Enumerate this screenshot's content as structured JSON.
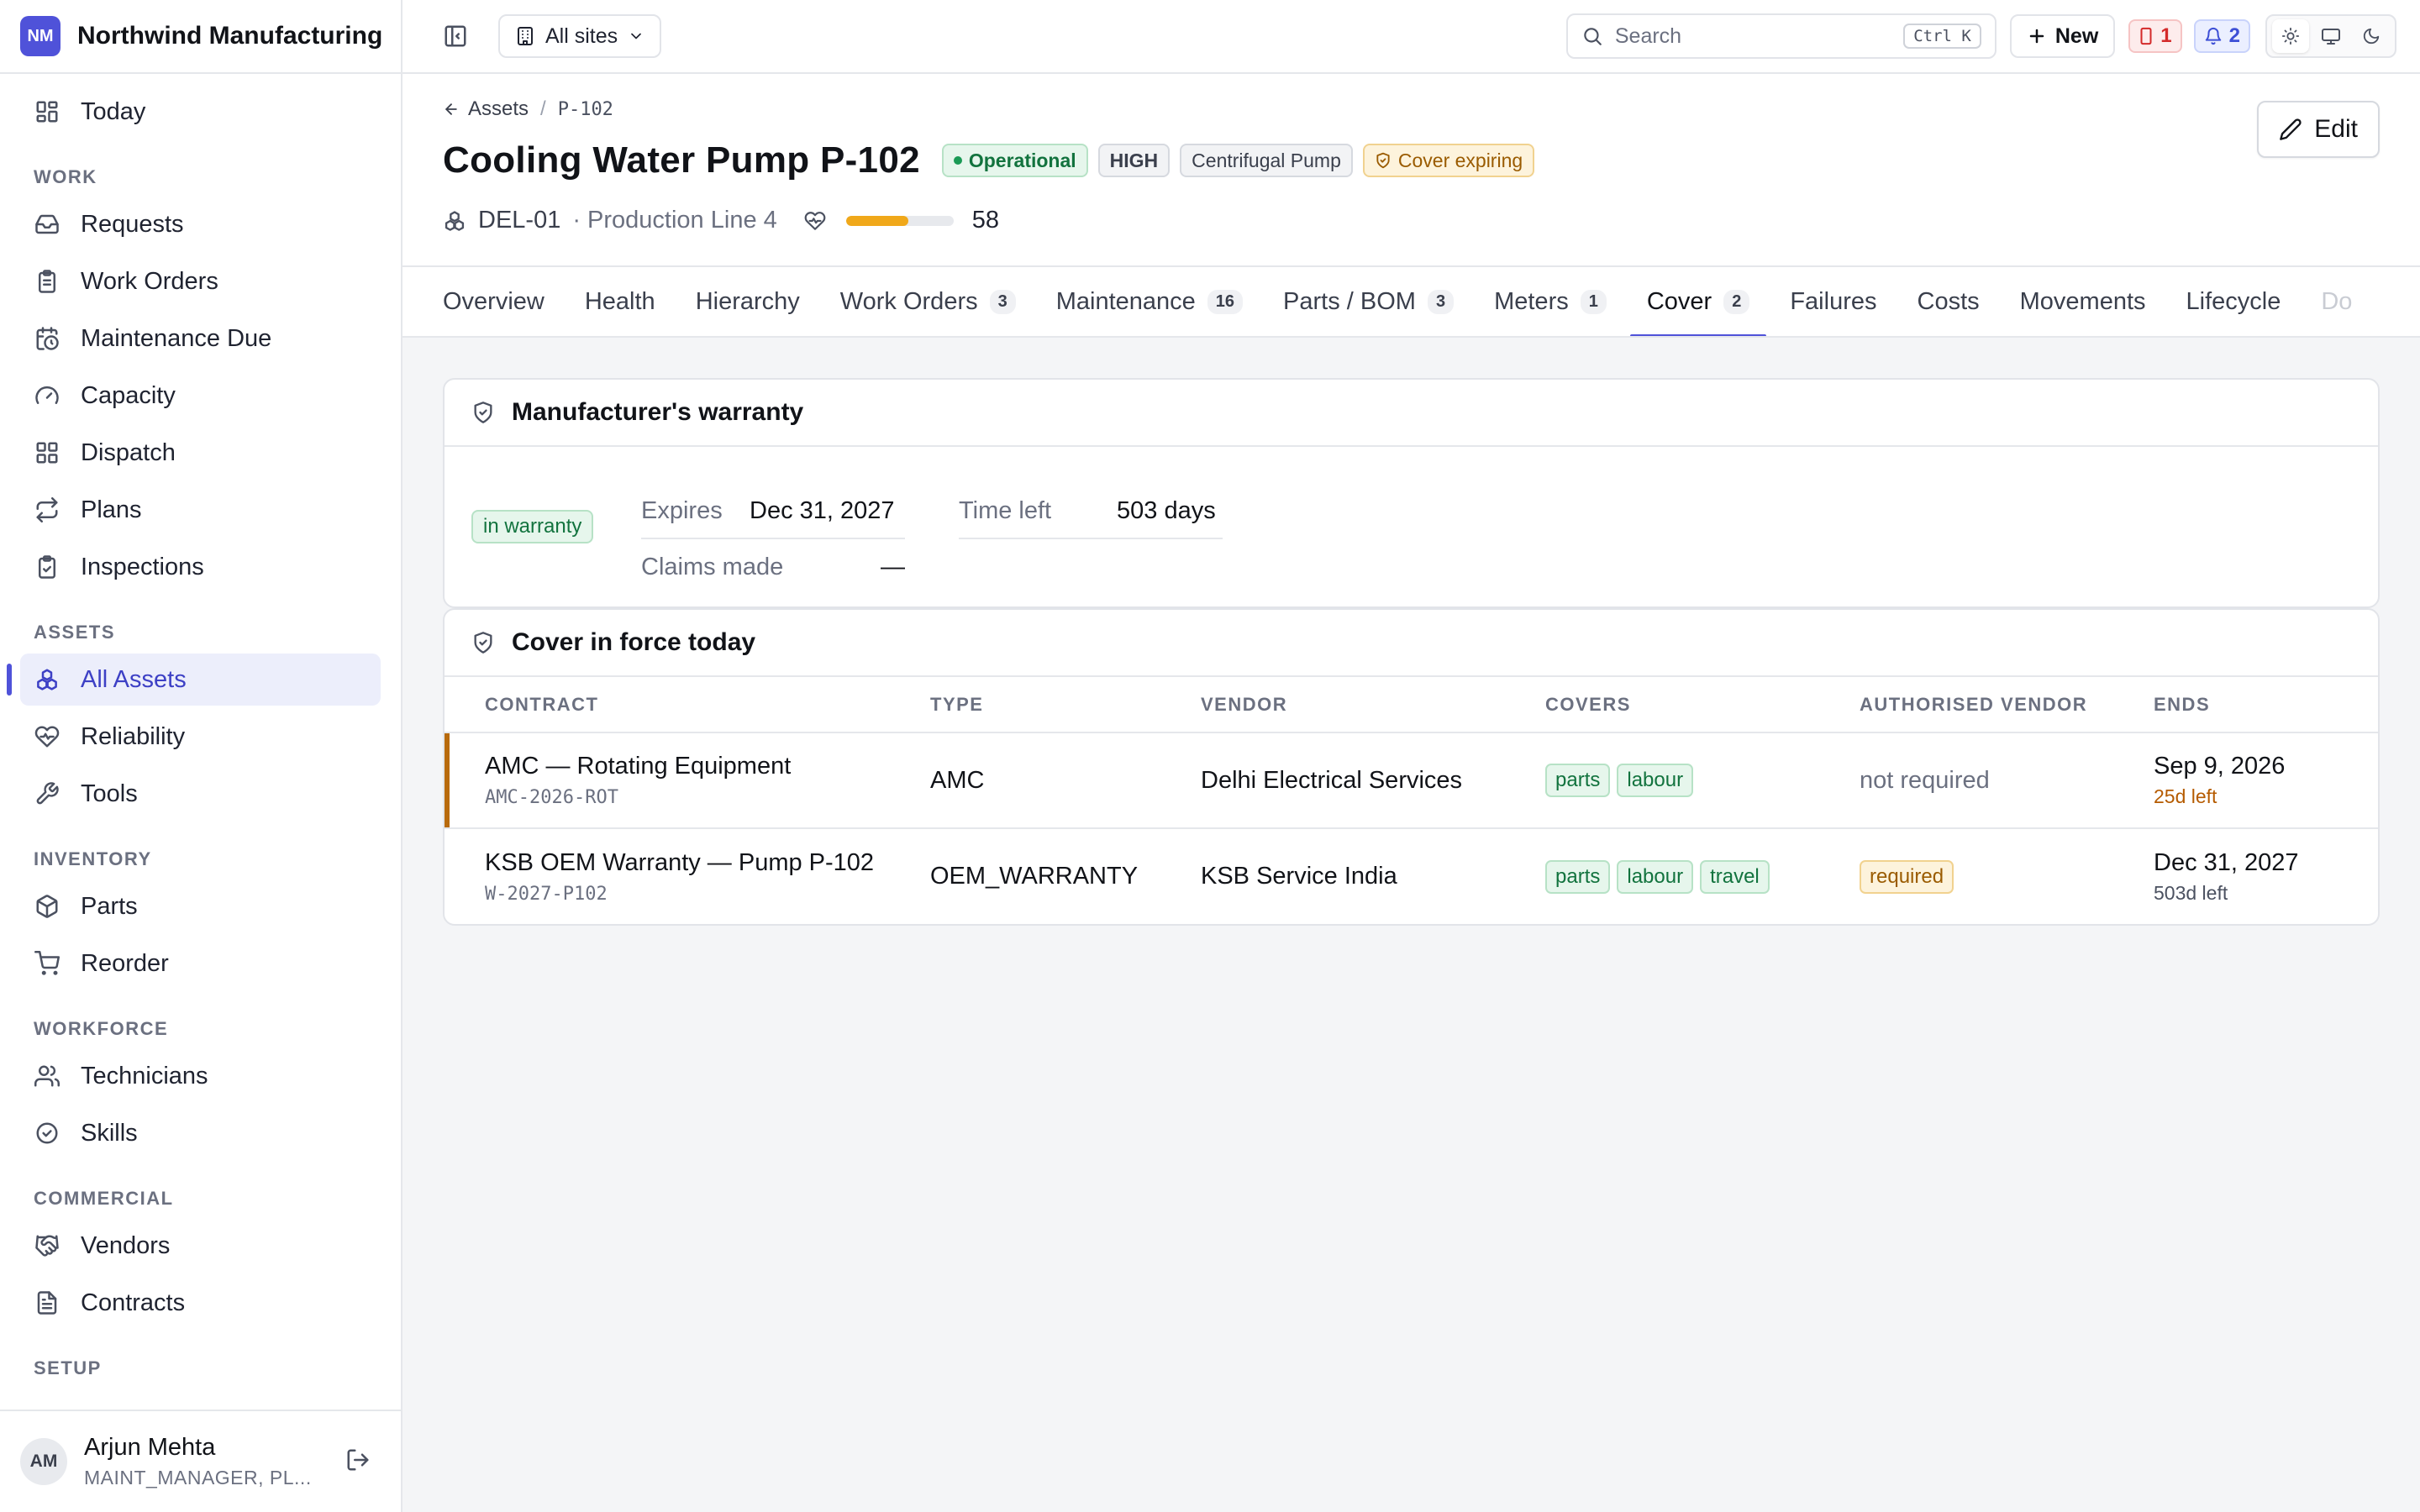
{
  "brand": {
    "initials": "NM",
    "name": "Northwind Manufacturing"
  },
  "sidebar": {
    "top": [
      {
        "label": "Today",
        "icon": "dashboard-icon"
      }
    ],
    "sections": [
      {
        "title": "WORK",
        "items": [
          {
            "label": "Requests",
            "icon": "inbox-icon"
          },
          {
            "label": "Work Orders",
            "icon": "clipboard-icon"
          },
          {
            "label": "Maintenance Due",
            "icon": "calendar-clock-icon"
          },
          {
            "label": "Capacity",
            "icon": "gauge-icon"
          },
          {
            "label": "Dispatch",
            "icon": "grid-icon"
          },
          {
            "label": "Plans",
            "icon": "repeat-icon"
          },
          {
            "label": "Inspections",
            "icon": "checklist-icon"
          }
        ]
      },
      {
        "title": "ASSETS",
        "items": [
          {
            "label": "All Assets",
            "icon": "assets-icon",
            "active": true
          },
          {
            "label": "Reliability",
            "icon": "heart-pulse-icon"
          },
          {
            "label": "Tools",
            "icon": "wrench-icon"
          }
        ]
      },
      {
        "title": "INVENTORY",
        "items": [
          {
            "label": "Parts",
            "icon": "package-icon"
          },
          {
            "label": "Reorder",
            "icon": "cart-icon"
          }
        ]
      },
      {
        "title": "WORKFORCE",
        "items": [
          {
            "label": "Technicians",
            "icon": "users-icon"
          },
          {
            "label": "Skills",
            "icon": "badge-check-icon"
          }
        ]
      },
      {
        "title": "COMMERCIAL",
        "items": [
          {
            "label": "Vendors",
            "icon": "handshake-icon"
          },
          {
            "label": "Contracts",
            "icon": "document-icon"
          }
        ]
      },
      {
        "title": "SETUP",
        "items": []
      }
    ]
  },
  "user": {
    "initials": "AM",
    "name": "Arjun Mehta",
    "role": "MAINT_MANAGER, PL..."
  },
  "topbar": {
    "site_select": "All sites",
    "search_placeholder": "Search",
    "search_shortcut": "Ctrl K",
    "new_label": "New",
    "alerts_count": "1",
    "notifications_count": "2"
  },
  "breadcrumb": {
    "parent": "Assets",
    "current": "P-102"
  },
  "asset": {
    "title": "Cooling Water Pump P-102",
    "status": "Operational",
    "criticality": "HIGH",
    "category": "Centrifugal Pump",
    "cover_status": "Cover expiring",
    "site_code": "DEL-01",
    "location": "· Production Line 4",
    "health_score": "58",
    "health_pct": 58
  },
  "edit_label": "Edit",
  "tabs": [
    {
      "label": "Overview",
      "count": ""
    },
    {
      "label": "Health",
      "count": ""
    },
    {
      "label": "Hierarchy",
      "count": ""
    },
    {
      "label": "Work Orders",
      "count": "3"
    },
    {
      "label": "Maintenance",
      "count": "16"
    },
    {
      "label": "Parts / BOM",
      "count": "3"
    },
    {
      "label": "Meters",
      "count": "1"
    },
    {
      "label": "Cover",
      "count": "2",
      "active": true
    },
    {
      "label": "Failures",
      "count": ""
    },
    {
      "label": "Costs",
      "count": ""
    },
    {
      "label": "Movements",
      "count": ""
    },
    {
      "label": "Lifecycle",
      "count": ""
    },
    {
      "label": "Do",
      "count": "",
      "faded": true
    }
  ],
  "warranty": {
    "title": "Manufacturer's warranty",
    "badge": "in warranty",
    "expires_label": "Expires",
    "expires_value": "Dec 31, 2027",
    "time_left_label": "Time left",
    "time_left_value": "503 days",
    "claims_label": "Claims made",
    "claims_value": "—"
  },
  "cover": {
    "title": "Cover in force today",
    "columns": [
      "CONTRACT",
      "TYPE",
      "VENDOR",
      "COVERS",
      "AUTHORISED VENDOR",
      "ENDS"
    ],
    "rows": [
      {
        "name": "AMC — Rotating Equipment",
        "code": "AMC-2026-ROT",
        "type": "AMC",
        "vendor": "Delhi Electrical Services",
        "covers": [
          "parts",
          "labour"
        ],
        "authorised": "not required",
        "authorised_required": false,
        "ends": "Sep 9, 2026",
        "left": "25d left",
        "expiring": true
      },
      {
        "name": "KSB OEM Warranty — Pump P-102",
        "code": "W-2027-P102",
        "type": "OEM_WARRANTY",
        "vendor": "KSB Service India",
        "covers": [
          "parts",
          "labour",
          "travel"
        ],
        "authorised": "required",
        "authorised_required": true,
        "ends": "Dec 31, 2027",
        "left": "503d left",
        "expiring": false
      }
    ]
  }
}
